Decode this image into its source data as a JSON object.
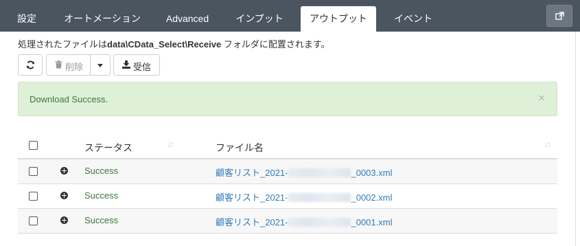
{
  "tabs": [
    {
      "label": "設定"
    },
    {
      "label": "オートメーション"
    },
    {
      "label": "Advanced"
    },
    {
      "label": "インプット"
    },
    {
      "label": "アウトプット",
      "active": true
    },
    {
      "label": "イベント"
    }
  ],
  "info": {
    "prefix": "処理されたファイルは",
    "path": "data\\CData_Select\\Receive",
    "suffix": " フォルダに配置されます。"
  },
  "toolbar": {
    "delete_label": "削除",
    "receive_label": "受信"
  },
  "alert": {
    "message": "Download Success.",
    "close": "×"
  },
  "table": {
    "columns": [
      "ステータス",
      "ファイル名"
    ],
    "rows": [
      {
        "status": "Success",
        "file_prefix": "顧客リスト_2021-",
        "file_suffix": "_0003.xml"
      },
      {
        "status": "Success",
        "file_prefix": "顧客リスト_2021-",
        "file_suffix": "_0002.xml"
      },
      {
        "status": "Success",
        "file_prefix": "顧客リスト_2021-",
        "file_suffix": "_0001.xml"
      }
    ]
  },
  "colors": {
    "topbar": "#4a5560",
    "success_bg": "#dff0d8",
    "success_text": "#3c763d",
    "link": "#337ab7"
  },
  "icons": [
    "refresh-icon",
    "trash-icon",
    "download-icon",
    "external-link-icon",
    "sort-icon",
    "plus-circle-icon",
    "close-icon"
  ]
}
